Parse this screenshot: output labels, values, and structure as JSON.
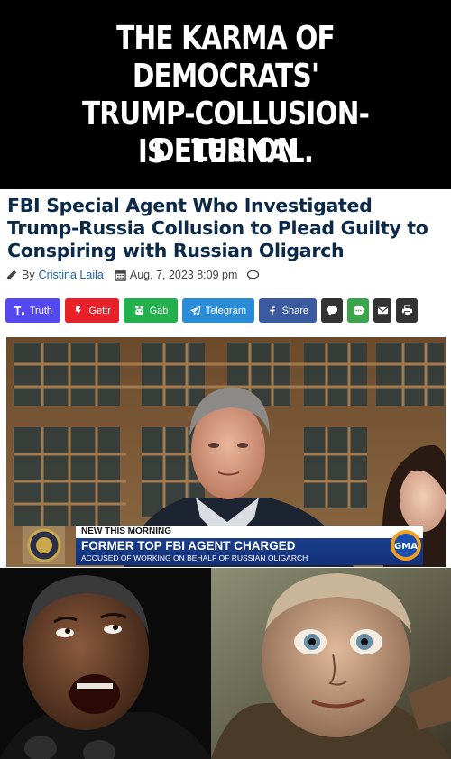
{
  "caption": {
    "lines": [
      "THE KARMA OF",
      "DEMOCRATS'",
      "TRUMP-COLLUSION-DELUSION",
      "IS ETERNAL."
    ]
  },
  "article": {
    "headline": "FBI Special Agent Who Investigated Trump-Russia Collusion to Plead Guilty to Conspiring with Russian Oligarch",
    "byline_prefix": "By",
    "author": "Cristina Laila",
    "date": "Aug. 7, 2023 8:09 pm"
  },
  "share_buttons": [
    {
      "label": "Truth",
      "icon": "truth-social-icon",
      "color": "#5448ee"
    },
    {
      "label": "Gettr",
      "icon": "gettr-icon",
      "color": "#e8202a"
    },
    {
      "label": "Gab",
      "icon": "gab-icon",
      "color": "#21b04b"
    },
    {
      "label": "Telegram",
      "icon": "telegram-icon",
      "color": "#2a8bd6"
    },
    {
      "label": "Share",
      "icon": "facebook-icon",
      "color": "#3b5aa0"
    }
  ],
  "chyron": {
    "kicker": "NEW THIS MORNING",
    "headline": "FORMER TOP FBI AGENT CHARGED",
    "subline": "ACCUSED OF WORKING ON BEHALF OF RUSSIAN OLIGARCH",
    "logo_text": "GMA"
  }
}
